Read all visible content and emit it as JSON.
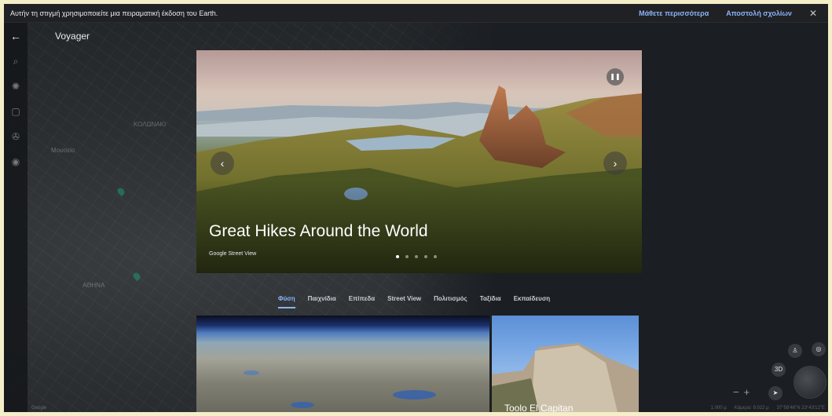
{
  "notice": {
    "message": "Αυτήν τη στιγμή χρησιμοποιείτε μια πειραματική έκδοση του Earth.",
    "learn_more": "Μάθετε περισσότερα",
    "send_feedback": "Αποστολή σχολίων",
    "close_icon": "close-icon"
  },
  "panel": {
    "title": "Voyager",
    "back_icon": "arrow-left-icon"
  },
  "rail_icons": [
    "search-icon",
    "settings-icon",
    "bookmark-icon",
    "voyager-icon",
    "location-icon"
  ],
  "hero": {
    "title": "Great Hikes Around the World",
    "credit": "Google Street View",
    "slides": 5,
    "active_slide": 0
  },
  "tabs": [
    {
      "label": "Φύση",
      "active": true
    },
    {
      "label": "Παιχνίδια",
      "active": false
    },
    {
      "label": "Επίπεδα",
      "active": false
    },
    {
      "label": "Street View",
      "active": false
    },
    {
      "label": "Πολιτισμός",
      "active": false
    },
    {
      "label": "Ταξίδια",
      "active": false
    },
    {
      "label": "Εκπαίδευση",
      "active": false
    }
  ],
  "cards": {
    "second_caption": "Toolo El Capitan"
  },
  "map_labels": {
    "area1": "ΚΟΛΩΝΑΚΙ",
    "area2": "ΑΘΗΝΑ",
    "area3": "Μουσείο"
  },
  "controls": {
    "view_3d": "3D",
    "zoom_in": "+",
    "zoom_out": "−"
  },
  "status": {
    "brand": "Google",
    "scale": "1.000 μ",
    "altitude": "Κάμερα: 9.022 μ",
    "coords": "37°58'46\"N 23°43'12\"E"
  },
  "colors": {
    "accent": "#8ab4f8",
    "frame": "#f5efc9"
  }
}
